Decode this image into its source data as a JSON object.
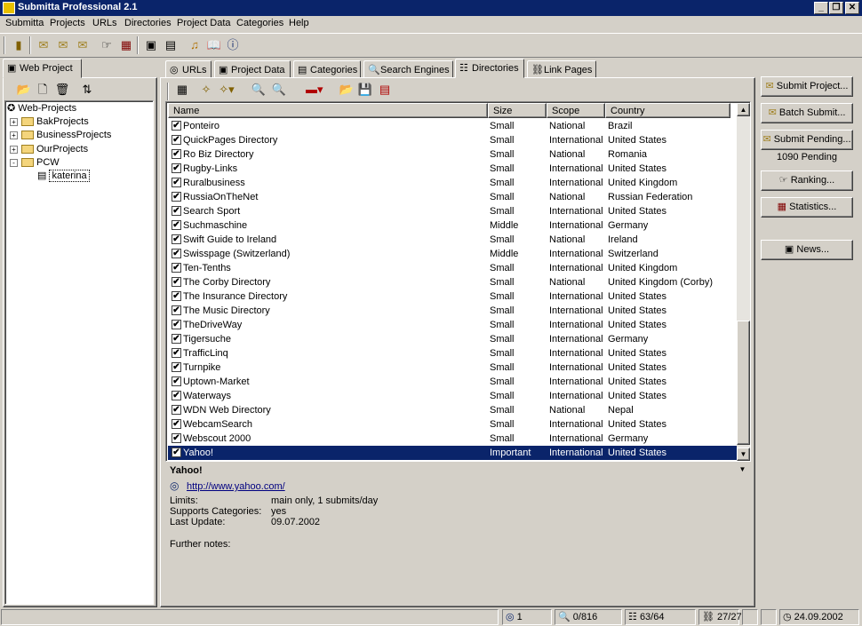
{
  "window": {
    "title": "Submitta Professional 2.1"
  },
  "menu": [
    "Submitta",
    "Projects",
    "URLs",
    "Directories",
    "Project Data",
    "Categories",
    "Help"
  ],
  "left_panel": {
    "tab_label": "Web Project",
    "tree": [
      {
        "label": "Web-Projects",
        "expander": ""
      },
      {
        "label": "BakProjects",
        "expander": "+"
      },
      {
        "label": "BusinessProjects",
        "expander": "+"
      },
      {
        "label": "OurProjects",
        "expander": "+"
      },
      {
        "label": "PCW",
        "expander": "-"
      },
      {
        "label": "katerina",
        "expander": ""
      }
    ]
  },
  "tabs": [
    "URLs",
    "Project Data",
    "Categories",
    "Search Engines",
    "Directories",
    "Link Pages"
  ],
  "list": {
    "columns": [
      "Name",
      "Size",
      "Scope",
      "Country"
    ],
    "rows": [
      {
        "name": "Ponteiro",
        "size": "Small",
        "scope": "National",
        "country": "Brazil"
      },
      {
        "name": "QuickPages Directory",
        "size": "Small",
        "scope": "International",
        "country": "United States"
      },
      {
        "name": "Ro Biz Directory",
        "size": "Small",
        "scope": "National",
        "country": "Romania"
      },
      {
        "name": "Rugby-Links",
        "size": "Small",
        "scope": "International",
        "country": "United States"
      },
      {
        "name": "Ruralbusiness",
        "size": "Small",
        "scope": "International",
        "country": "United Kingdom"
      },
      {
        "name": "RussiaOnTheNet",
        "size": "Small",
        "scope": "National",
        "country": "Russian Federation"
      },
      {
        "name": "Search Sport",
        "size": "Small",
        "scope": "International",
        "country": "United States"
      },
      {
        "name": "Suchmaschine",
        "size": "Middle",
        "scope": "International",
        "country": "Germany"
      },
      {
        "name": "Swift Guide to Ireland",
        "size": "Small",
        "scope": "National",
        "country": "Ireland"
      },
      {
        "name": "Swisspage (Switzerland)",
        "size": "Middle",
        "scope": "International",
        "country": "Switzerland"
      },
      {
        "name": "Ten-Tenths",
        "size": "Small",
        "scope": "International",
        "country": "United Kingdom"
      },
      {
        "name": "The Corby Directory",
        "size": "Small",
        "scope": "National",
        "country": "United Kingdom (Corby)"
      },
      {
        "name": "The Insurance Directory",
        "size": "Small",
        "scope": "International",
        "country": "United States"
      },
      {
        "name": "The Music Directory",
        "size": "Small",
        "scope": "International",
        "country": "United States"
      },
      {
        "name": "TheDriveWay",
        "size": "Small",
        "scope": "International",
        "country": "United States"
      },
      {
        "name": "Tigersuche",
        "size": "Small",
        "scope": "International",
        "country": "Germany"
      },
      {
        "name": "TrafficLinq",
        "size": "Small",
        "scope": "International",
        "country": "United States"
      },
      {
        "name": "Turnpike",
        "size": "Small",
        "scope": "International",
        "country": "United States"
      },
      {
        "name": "Uptown-Market",
        "size": "Small",
        "scope": "International",
        "country": "United States"
      },
      {
        "name": "Waterways",
        "size": "Small",
        "scope": "International",
        "country": "United States"
      },
      {
        "name": "WDN Web Directory",
        "size": "Small",
        "scope": "National",
        "country": "Nepal"
      },
      {
        "name": "WebcamSearch",
        "size": "Small",
        "scope": "International",
        "country": "United States"
      },
      {
        "name": "Webscout 2000",
        "size": "Small",
        "scope": "International",
        "country": "Germany"
      },
      {
        "name": "Yahoo!",
        "size": "Important",
        "scope": "International",
        "country": "United States"
      }
    ],
    "selected_name": "Yahoo!"
  },
  "detail": {
    "title": "Yahoo!",
    "url": "http://www.yahoo.com/",
    "fields": [
      {
        "label": "Limits:",
        "value": "main only, 1 submits/day"
      },
      {
        "label": "Supports Categories:",
        "value": "yes"
      },
      {
        "label": "Last Update:",
        "value": "09.07.2002"
      }
    ],
    "notes_label": "Further notes:"
  },
  "actions": {
    "submit_project": "Submit Project...",
    "batch_submit": "Batch Submit...",
    "submit_pending": "Submit Pending...",
    "pending_count": "1090 Pending",
    "ranking": "Ranking...",
    "statistics": "Statistics...",
    "news": "News..."
  },
  "status": {
    "globe": "1",
    "search": "0/816",
    "dirs": "63/64",
    "links": "27/27",
    "date": "24.09.2002"
  },
  "colors": {
    "titlebar": "#0a246a",
    "selection": "#0a246a",
    "window": "#d4d0c8"
  }
}
